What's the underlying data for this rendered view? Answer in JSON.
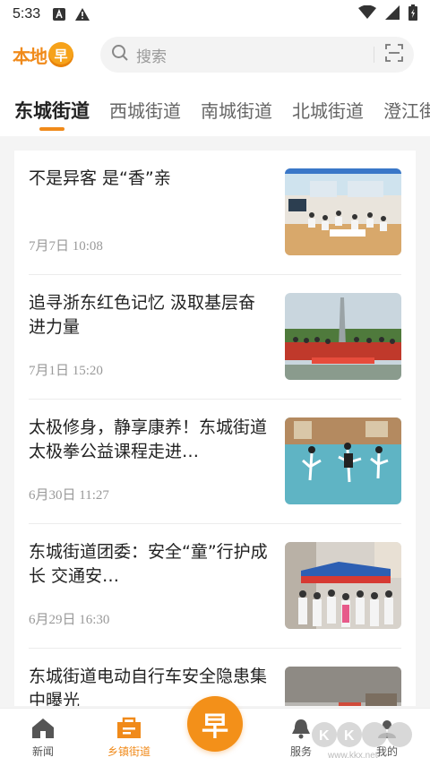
{
  "status": {
    "time": "5:33"
  },
  "header": {
    "logo_text": "本地",
    "logo_badge": "早",
    "search_placeholder": "搜索"
  },
  "tabs": [
    {
      "label": "东城街道",
      "active": true
    },
    {
      "label": "西城街道"
    },
    {
      "label": "南城街道"
    },
    {
      "label": "北城街道"
    },
    {
      "label": "澄江街"
    }
  ],
  "feed": [
    {
      "title": "不是异客  是“香”亲",
      "date": "7月7日  10:08"
    },
    {
      "title": "追寻浙东红色记忆  汲取基层奋进力量",
      "date": "7月1日  15:20"
    },
    {
      "title": "太极修身，静享康养！东城街道太极拳公益课程走进…",
      "date": "6月30日  11:27"
    },
    {
      "title": "东城街道团委：安全“童”行护成长  交通安…",
      "date": "6月29日  16:30"
    },
    {
      "title": "东城街道电动自行车安全隐患集中曝光",
      "date": ""
    }
  ],
  "bottom_nav": {
    "news": "新闻",
    "street": "乡镇街道",
    "center": "早",
    "service": "服务",
    "mine": "我的"
  },
  "watermark": {
    "text": "KK下载",
    "url": "www.kkx.net"
  },
  "colors": {
    "accent": "#f08a1a"
  }
}
